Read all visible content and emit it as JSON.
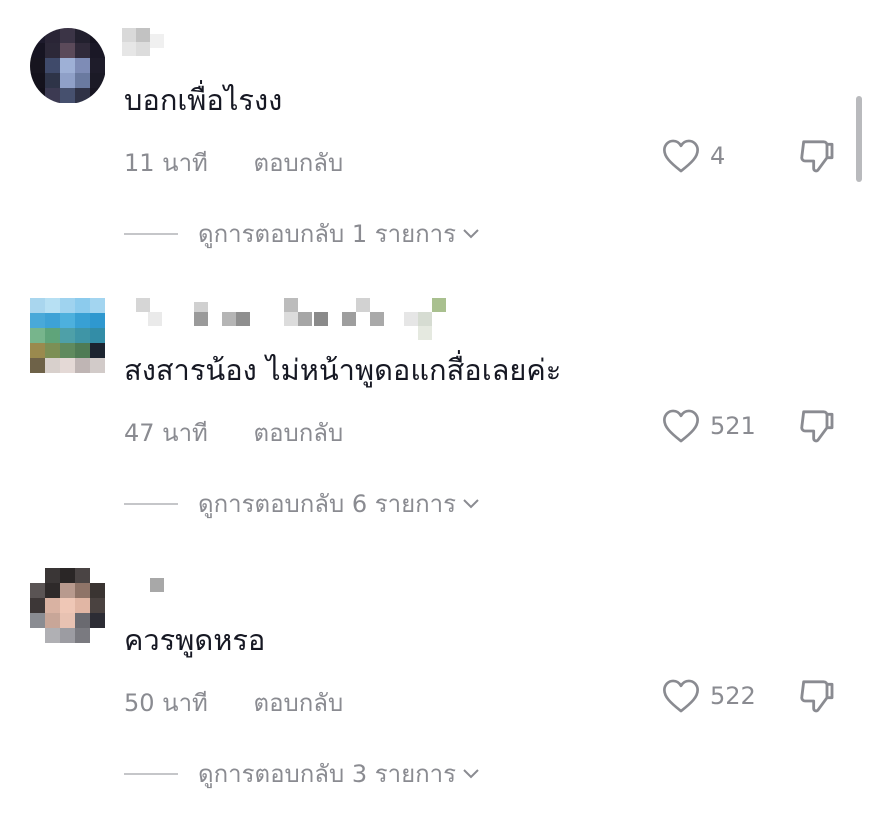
{
  "comments": [
    {
      "text": "บอกเพื่อไรงง",
      "time": "11 นาที",
      "reply_label": "ตอบกลับ",
      "likes": "4",
      "view_replies": "ดูการตอบกลับ 1 รายการ"
    },
    {
      "text": "สงสารน้อง ไม่หน้าพูดอแกสื่อเลยค่ะ",
      "time": "47 นาที",
      "reply_label": "ตอบกลับ",
      "likes": "521",
      "view_replies": "ดูการตอบกลับ 6 รายการ"
    },
    {
      "text": "ควรพูดหรอ",
      "time": "50 นาที",
      "reply_label": "ตอบกลับ",
      "likes": "522",
      "view_replies": "ดูการตอบกลับ 3 รายการ"
    }
  ],
  "icons": {
    "like": "heart-outline-icon",
    "dislike": "thumbs-down-icon",
    "expand": "chevron-down-icon"
  },
  "colors": {
    "text_primary": "#161823",
    "text_secondary": "#8a8b91"
  }
}
